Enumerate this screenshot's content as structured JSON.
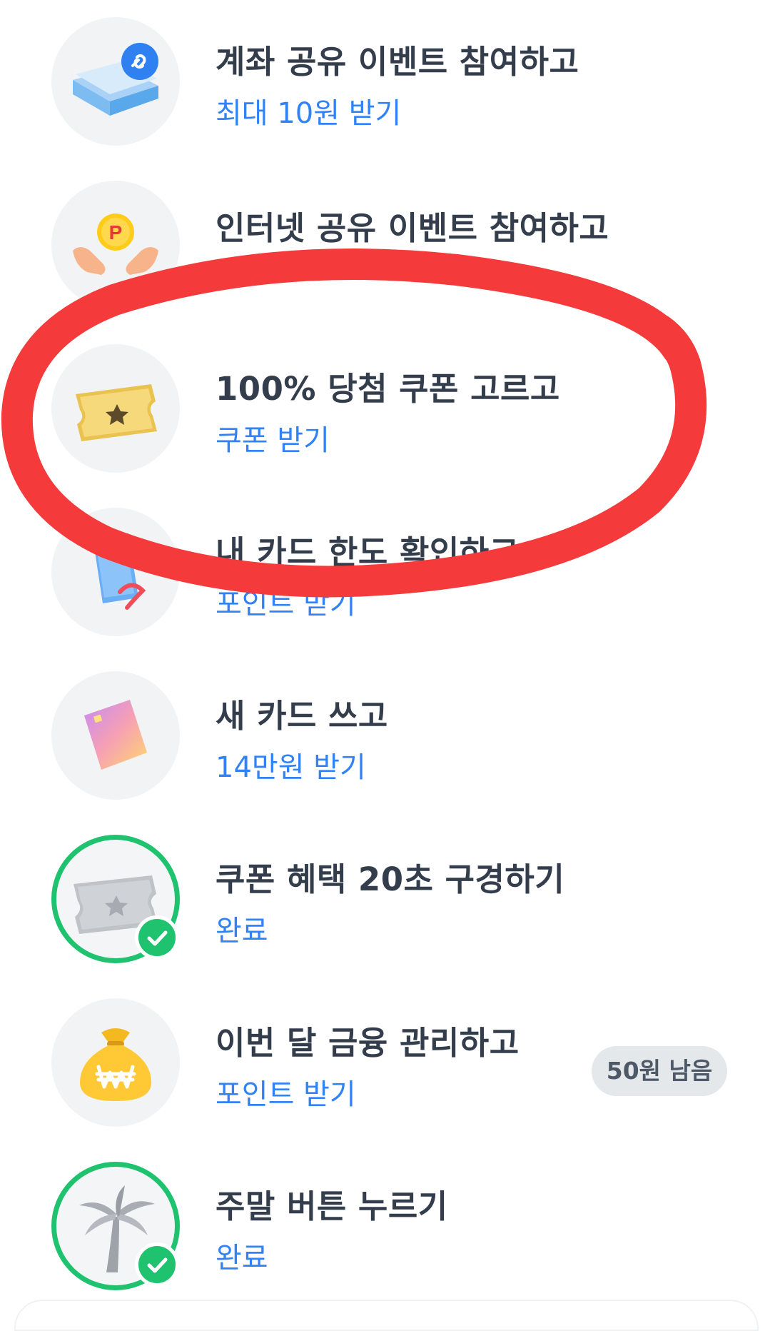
{
  "rows": [
    {
      "title": "계좌 공유 이벤트 참여하고",
      "sub": "최대 10원 받기",
      "icon": "account-share-icon"
    },
    {
      "title": "인터넷 공유 이벤트 참여하고",
      "sub": "",
      "icon": "point-coin-hands-icon"
    },
    {
      "title": "100% 당첨 쿠폰 고르고",
      "sub": "쿠폰 받기",
      "icon": "gold-ticket-icon"
    },
    {
      "title": "내 카드 한도 확인하고",
      "sub": "포인트 받기",
      "icon": "blue-card-icon"
    },
    {
      "title": "새 카드 쓰고",
      "sub": "14만원 받기",
      "icon": "gradient-card-icon"
    },
    {
      "title": "쿠폰 혜택 20초 구경하기",
      "sub": "완료",
      "icon": "silver-ticket-icon",
      "status": "done"
    },
    {
      "title": "이번 달 금융 관리하고",
      "sub": "포인트 받기",
      "icon": "money-bag-icon",
      "badge": "50원 남음"
    },
    {
      "title": "주말 버튼 누르기",
      "sub": "완료",
      "icon": "palm-tree-icon",
      "status": "done"
    }
  ],
  "colors": {
    "title": "#333d4b",
    "sub": "#3182f6",
    "done_ring": "#1fc26f",
    "annotation": "#f43a3a"
  }
}
